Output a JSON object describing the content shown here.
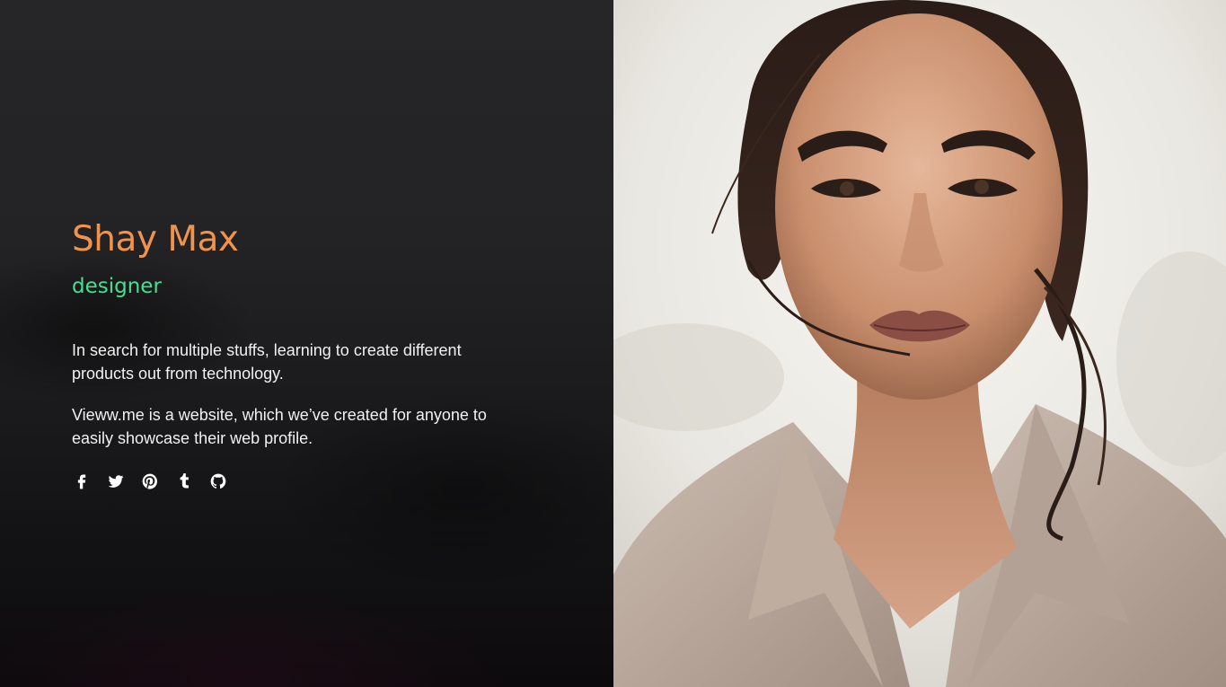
{
  "profile": {
    "name": "Shay Max",
    "role": "designer",
    "bio": [
      "In search for multiple stuffs, learning to create different products out from technology.",
      "Vieww.me is a website, which we’ve created for anyone to easily showcase their web profile."
    ]
  },
  "socials": [
    {
      "icon": "facebook-icon"
    },
    {
      "icon": "twitter-icon"
    },
    {
      "icon": "pinterest-icon"
    },
    {
      "icon": "tumblr-icon"
    },
    {
      "icon": "github-icon"
    }
  ],
  "colors": {
    "name": "#f0934c",
    "role": "#45e08f",
    "text": "#f1f1f1",
    "panel": "#232325"
  },
  "portrait": {
    "subject": "portrait-photo"
  }
}
